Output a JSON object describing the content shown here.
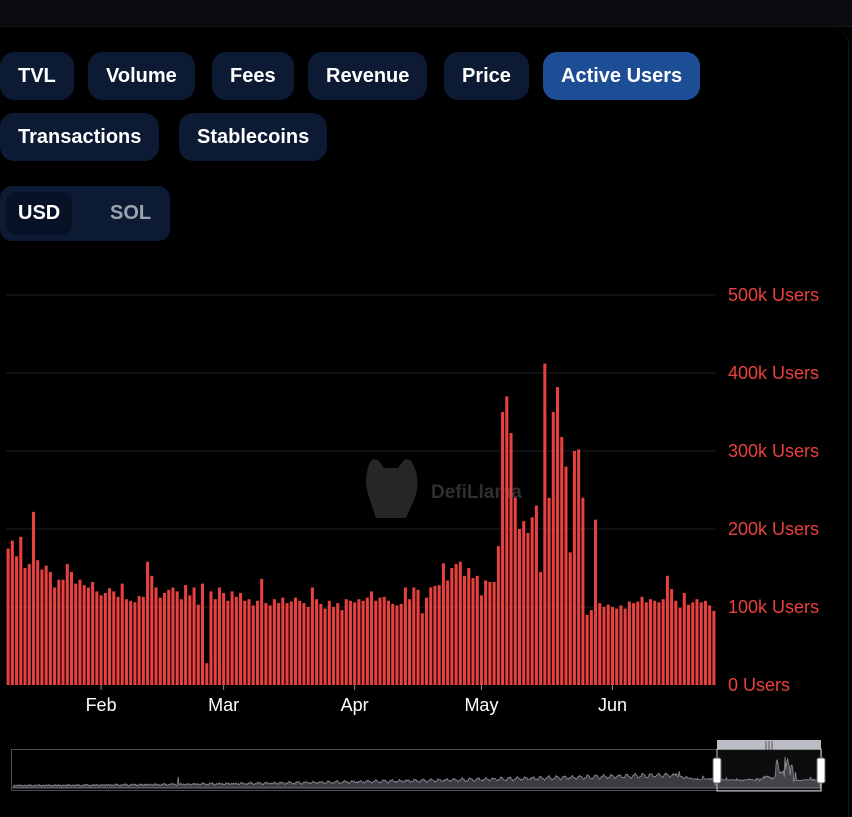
{
  "tabs": [
    {
      "label": "TVL",
      "active": false
    },
    {
      "label": "Volume",
      "active": false
    },
    {
      "label": "Fees",
      "active": false
    },
    {
      "label": "Revenue",
      "active": false
    },
    {
      "label": "Price",
      "active": false
    },
    {
      "label": "Active Users",
      "active": true
    },
    {
      "label": "Transactions",
      "active": false
    },
    {
      "label": "Stablecoins",
      "active": false
    }
  ],
  "currency": {
    "selected": "USD",
    "other": "SOL"
  },
  "watermark": "DefiLlama",
  "colors": {
    "bar": "#e8413f",
    "axis_label": "#e8413f",
    "tab_bg": "#0c1a33",
    "tab_active": "#1d4d94"
  },
  "chart_data": {
    "type": "bar",
    "ylabel": "",
    "y_unit": "Users",
    "ylim": [
      0,
      500000
    ],
    "y_ticks": [
      "0 Users",
      "100k Users",
      "200k Users",
      "300k Users",
      "400k Users",
      "500k Users"
    ],
    "x_ticks": [
      {
        "label": "Feb",
        "index": 22
      },
      {
        "label": "Mar",
        "index": 51
      },
      {
        "label": "Apr",
        "index": 82
      },
      {
        "label": "May",
        "index": 112
      },
      {
        "label": "Jun",
        "index": 143
      }
    ],
    "y_axis_position": "right",
    "grid": true,
    "series": [
      {
        "values": [
          175000,
          185000,
          165000,
          190000,
          150000,
          155000,
          222000,
          160000,
          148000,
          153000,
          145000,
          125000,
          135000,
          135000,
          155000,
          145000,
          130000,
          135000,
          128000,
          125000,
          132000,
          120000,
          115000,
          118000,
          124000,
          120000,
          113000,
          130000,
          110000,
          108000,
          106000,
          114000,
          113000,
          158000,
          140000,
          125000,
          112000,
          118000,
          122000,
          125000,
          120000,
          110000,
          128000,
          115000,
          125000,
          103000,
          130000,
          28000,
          120000,
          110000,
          125000,
          118000,
          108000,
          120000,
          113000,
          118000,
          108000,
          110000,
          102000,
          108000,
          136000,
          105000,
          102000,
          110000,
          105000,
          112000,
          105000,
          107000,
          112000,
          108000,
          105000,
          100000,
          125000,
          110000,
          104000,
          98000,
          108000,
          100000,
          105000,
          96000,
          110000,
          108000,
          106000,
          110000,
          108000,
          112000,
          120000,
          108000,
          112000,
          113000,
          108000,
          104000,
          102000,
          104000,
          125000,
          110000,
          125000,
          122000,
          92000,
          112000,
          125000,
          127000,
          128000,
          156000,
          134000,
          150000,
          155000,
          158000,
          140000,
          150000,
          137000,
          140000,
          115000,
          134000,
          132000,
          132000,
          178000,
          350000,
          370000,
          323000,
          240000,
          200000,
          210000,
          195000,
          215000,
          230000,
          145000,
          412000,
          240000,
          350000,
          382000,
          318000,
          280000,
          170000,
          300000,
          302000,
          240000,
          90000,
          96000,
          212000,
          105000,
          100000,
          103000,
          100000,
          98000,
          102000,
          98000,
          107000,
          105000,
          107000,
          113000,
          106000,
          110000,
          108000,
          106000,
          110000,
          140000,
          123000,
          108000,
          99000,
          118000,
          103000,
          106000,
          110000,
          106000,
          108000,
          102000,
          95000
        ]
      }
    ]
  }
}
